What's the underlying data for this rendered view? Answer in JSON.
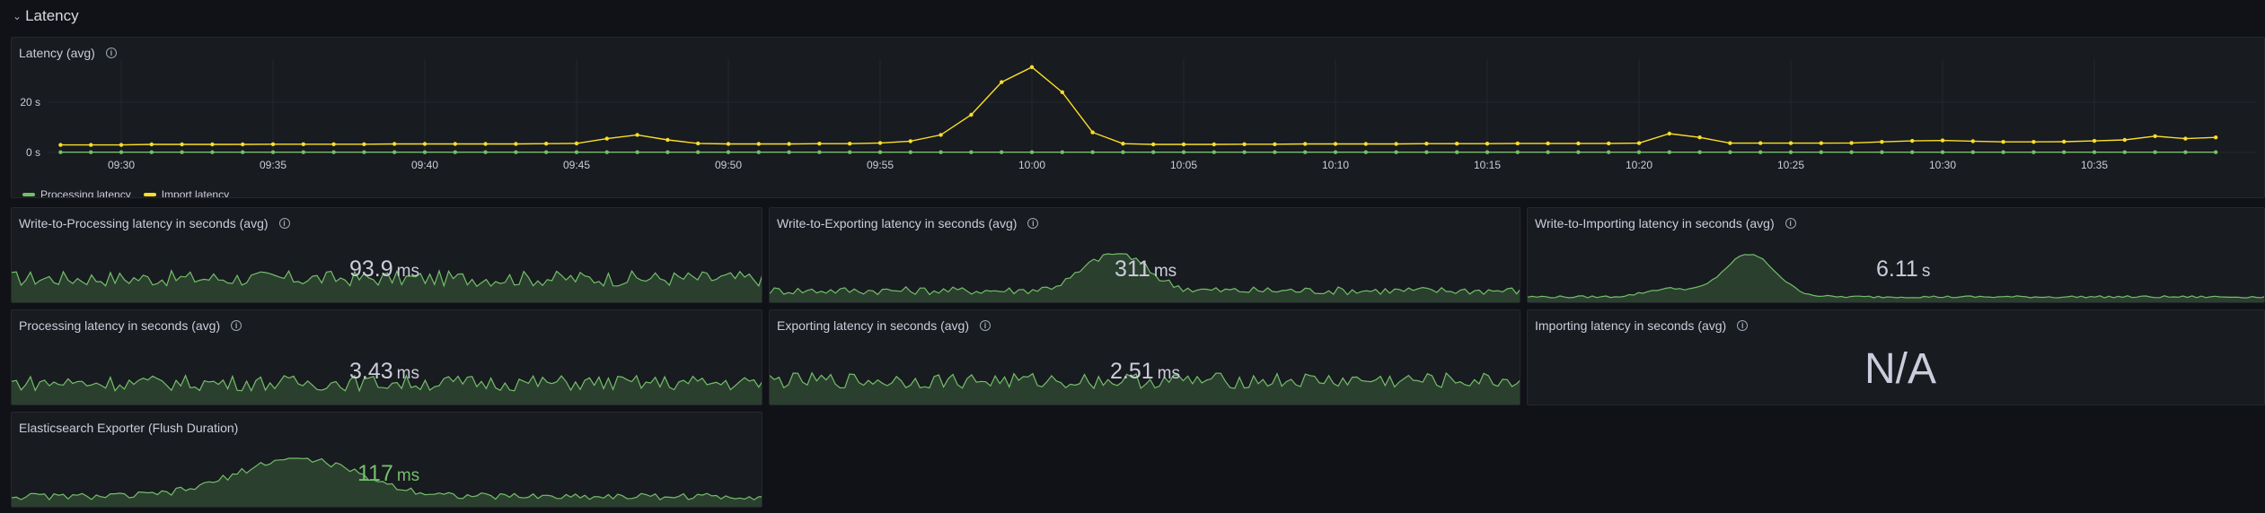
{
  "colors": {
    "green": "#73bf69",
    "yellow": "#fade2a",
    "grid": "#2a2d33"
  },
  "row": {
    "chevron": "⌄",
    "title": "Latency"
  },
  "timeseries": {
    "title": "Latency (avg)",
    "legend": [
      "Processing latency",
      "Import latency"
    ]
  },
  "chart_data": {
    "type": "line",
    "title": "Latency (avg)",
    "x": [
      "09:28",
      "09:29",
      "09:30",
      "09:31",
      "09:32",
      "09:33",
      "09:34",
      "09:35",
      "09:36",
      "09:37",
      "09:38",
      "09:39",
      "09:40",
      "09:41",
      "09:42",
      "09:43",
      "09:44",
      "09:45",
      "09:46",
      "09:47",
      "09:48",
      "09:49",
      "09:50",
      "09:51",
      "09:52",
      "09:53",
      "09:54",
      "09:55",
      "09:56",
      "09:57",
      "09:58",
      "09:59",
      "10:00",
      "10:01",
      "10:02",
      "10:03",
      "10:04",
      "10:05",
      "10:06",
      "10:07",
      "10:08",
      "10:09",
      "10:10",
      "10:11",
      "10:12",
      "10:13",
      "10:14",
      "10:15",
      "10:16",
      "10:17",
      "10:18",
      "10:19",
      "10:20",
      "10:21",
      "10:22",
      "10:23",
      "10:24",
      "10:25",
      "10:26",
      "10:27",
      "10:28",
      "10:29",
      "10:30",
      "10:31",
      "10:32",
      "10:33",
      "10:34",
      "10:35",
      "10:36",
      "10:37",
      "10:38",
      "10:39"
    ],
    "x_ticks": [
      "09:30",
      "09:35",
      "09:40",
      "09:45",
      "09:50",
      "09:55",
      "10:00",
      "10:05",
      "10:10",
      "10:15",
      "10:20",
      "10:25",
      "10:30",
      "10:35"
    ],
    "y_ticks": [
      "0 s",
      "20 s"
    ],
    "ylim": [
      0,
      35
    ],
    "series": [
      {
        "name": "Processing latency",
        "color": "#73bf69",
        "values": [
          0.1,
          0.1,
          0.1,
          0.1,
          0.1,
          0.1,
          0.1,
          0.1,
          0.1,
          0.1,
          0.1,
          0.1,
          0.1,
          0.1,
          0.1,
          0.1,
          0.1,
          0.1,
          0.1,
          0.1,
          0.1,
          0.1,
          0.1,
          0.1,
          0.1,
          0.1,
          0.1,
          0.1,
          0.1,
          0.1,
          0.1,
          0.1,
          0.1,
          0.1,
          0.1,
          0.1,
          0.1,
          0.1,
          0.1,
          0.1,
          0.1,
          0.1,
          0.1,
          0.1,
          0.1,
          0.1,
          0.1,
          0.1,
          0.1,
          0.1,
          0.1,
          0.1,
          0.1,
          0.1,
          0.1,
          0.1,
          0.1,
          0.1,
          0.1,
          0.1,
          0.1,
          0.1,
          0.1,
          0.1,
          0.1,
          0.1,
          0.1,
          0.1,
          0.1,
          0.1,
          0.1,
          0.1
        ]
      },
      {
        "name": "Import latency",
        "color": "#fade2a",
        "values": [
          3,
          3,
          3,
          3.2,
          3.2,
          3.2,
          3.2,
          3.3,
          3.3,
          3.3,
          3.3,
          3.4,
          3.4,
          3.4,
          3.4,
          3.4,
          3.5,
          3.6,
          5.5,
          7,
          5,
          3.6,
          3.4,
          3.4,
          3.4,
          3.5,
          3.5,
          3.8,
          4.5,
          7,
          15,
          28,
          34,
          24,
          8,
          3.5,
          3.2,
          3.2,
          3.2,
          3.3,
          3.3,
          3.4,
          3.4,
          3.4,
          3.4,
          3.5,
          3.5,
          3.5,
          3.6,
          3.6,
          3.6,
          3.6,
          3.7,
          7.5,
          6,
          3.7,
          3.7,
          3.7,
          3.7,
          3.8,
          4.2,
          4.6,
          4.8,
          4.5,
          4.2,
          4.2,
          4.3,
          4.6,
          5,
          6.5,
          5.5,
          6
        ]
      }
    ]
  },
  "stats": [
    {
      "title": "Write-to-Processing latency in seconds (avg)",
      "value": "93.9",
      "unit": "ms",
      "color": "default"
    },
    {
      "title": "Write-to-Exporting latency in seconds (avg)",
      "value": "311",
      "unit": "ms",
      "color": "default"
    },
    {
      "title": "Write-to-Importing latency in seconds (avg)",
      "value": "6.11",
      "unit": "s",
      "color": "default"
    },
    {
      "title": "Processing latency in seconds (avg)",
      "value": "3.43",
      "unit": "ms",
      "color": "default"
    },
    {
      "title": "Exporting latency in seconds (avg)",
      "value": "2.51",
      "unit": "ms",
      "color": "default"
    },
    {
      "title": "Importing latency in seconds (avg)",
      "value": "N/A",
      "unit": "",
      "color": "default"
    },
    {
      "title": "Elasticsearch Exporter (Flush Duration)",
      "value": "117",
      "unit": "ms",
      "color": "green"
    }
  ]
}
